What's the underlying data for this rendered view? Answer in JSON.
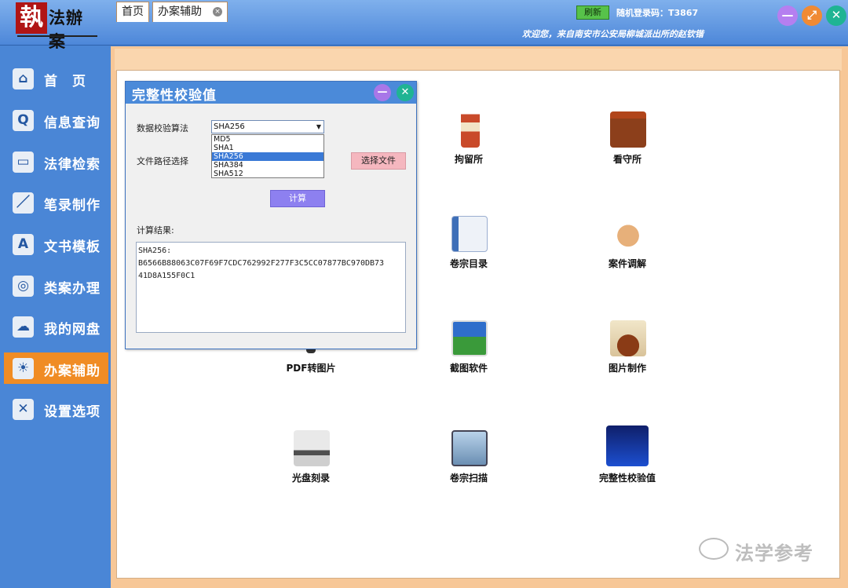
{
  "header": {
    "logo_text": "执法办案",
    "refresh_label": "刷新",
    "login_code": "随机登录码：T3867",
    "welcome": "欢迎您，来自南安市公安局柳城派出所的赵钦锴",
    "window_buttons": [
      "—",
      "⤢",
      "✕"
    ]
  },
  "sidebar": {
    "items": [
      {
        "label": "首　页",
        "icon": "home-icon",
        "glyph": "⌂"
      },
      {
        "label": "信息查询",
        "icon": "search-icon",
        "glyph": "Q"
      },
      {
        "label": "法律检索",
        "icon": "folder-icon",
        "glyph": "▭"
      },
      {
        "label": "笔录制作",
        "icon": "pen-icon",
        "glyph": "／"
      },
      {
        "label": "文书模板",
        "icon": "template-icon",
        "glyph": "A"
      },
      {
        "label": "类案办理",
        "icon": "globe-icon",
        "glyph": "◎"
      },
      {
        "label": "我的网盘",
        "icon": "cloud-drive-icon",
        "glyph": "☁"
      },
      {
        "label": "办案辅助",
        "icon": "assist-icon",
        "glyph": "☀",
        "active": true
      },
      {
        "label": "设置选项",
        "icon": "settings-icon",
        "glyph": "✕"
      }
    ],
    "active_color": "#f08c24"
  },
  "tabs": {
    "home": "首页",
    "assist": "办案辅助",
    "close_glyph": "×"
  },
  "apps": [
    {
      "label": "拘留所",
      "icon": "lighthouse-icon"
    },
    {
      "label": "看守所",
      "icon": "castle-icon"
    },
    {
      "label": "卷宗目录",
      "icon": "notebook-icon"
    },
    {
      "label": "案件调解",
      "icon": "handshake-icon"
    },
    {
      "label": "PDF转图片",
      "icon": "pdf-icon"
    },
    {
      "label": "截图软件",
      "icon": "screenshot-icon"
    },
    {
      "label": "图片制作",
      "icon": "stamp-icon"
    },
    {
      "label": "光盘刻录",
      "icon": "disc-burner-icon"
    },
    {
      "label": "卷宗扫描",
      "icon": "scanner-icon"
    },
    {
      "label": "完整性校验值",
      "icon": "hash-check-icon"
    }
  ],
  "dialog": {
    "title": "完整性校验值",
    "algorithm_label": "数据校验算法",
    "algorithm_selected": "SHA256",
    "algorithm_options": [
      "MD5",
      "SHA1",
      "SHA256",
      "SHA384",
      "SHA512"
    ],
    "path_label": "文件路径选择",
    "choose_file_label": "选择文件",
    "calculate_label": "计算",
    "result_label": "计算结果:",
    "result_lines": [
      "SHA256:",
      "B6566B88063C07F69F7CDC762992F277F3C5CC07877BC970DB73",
      "41D8A155F0C1"
    ]
  },
  "watermark": "法学参考"
}
